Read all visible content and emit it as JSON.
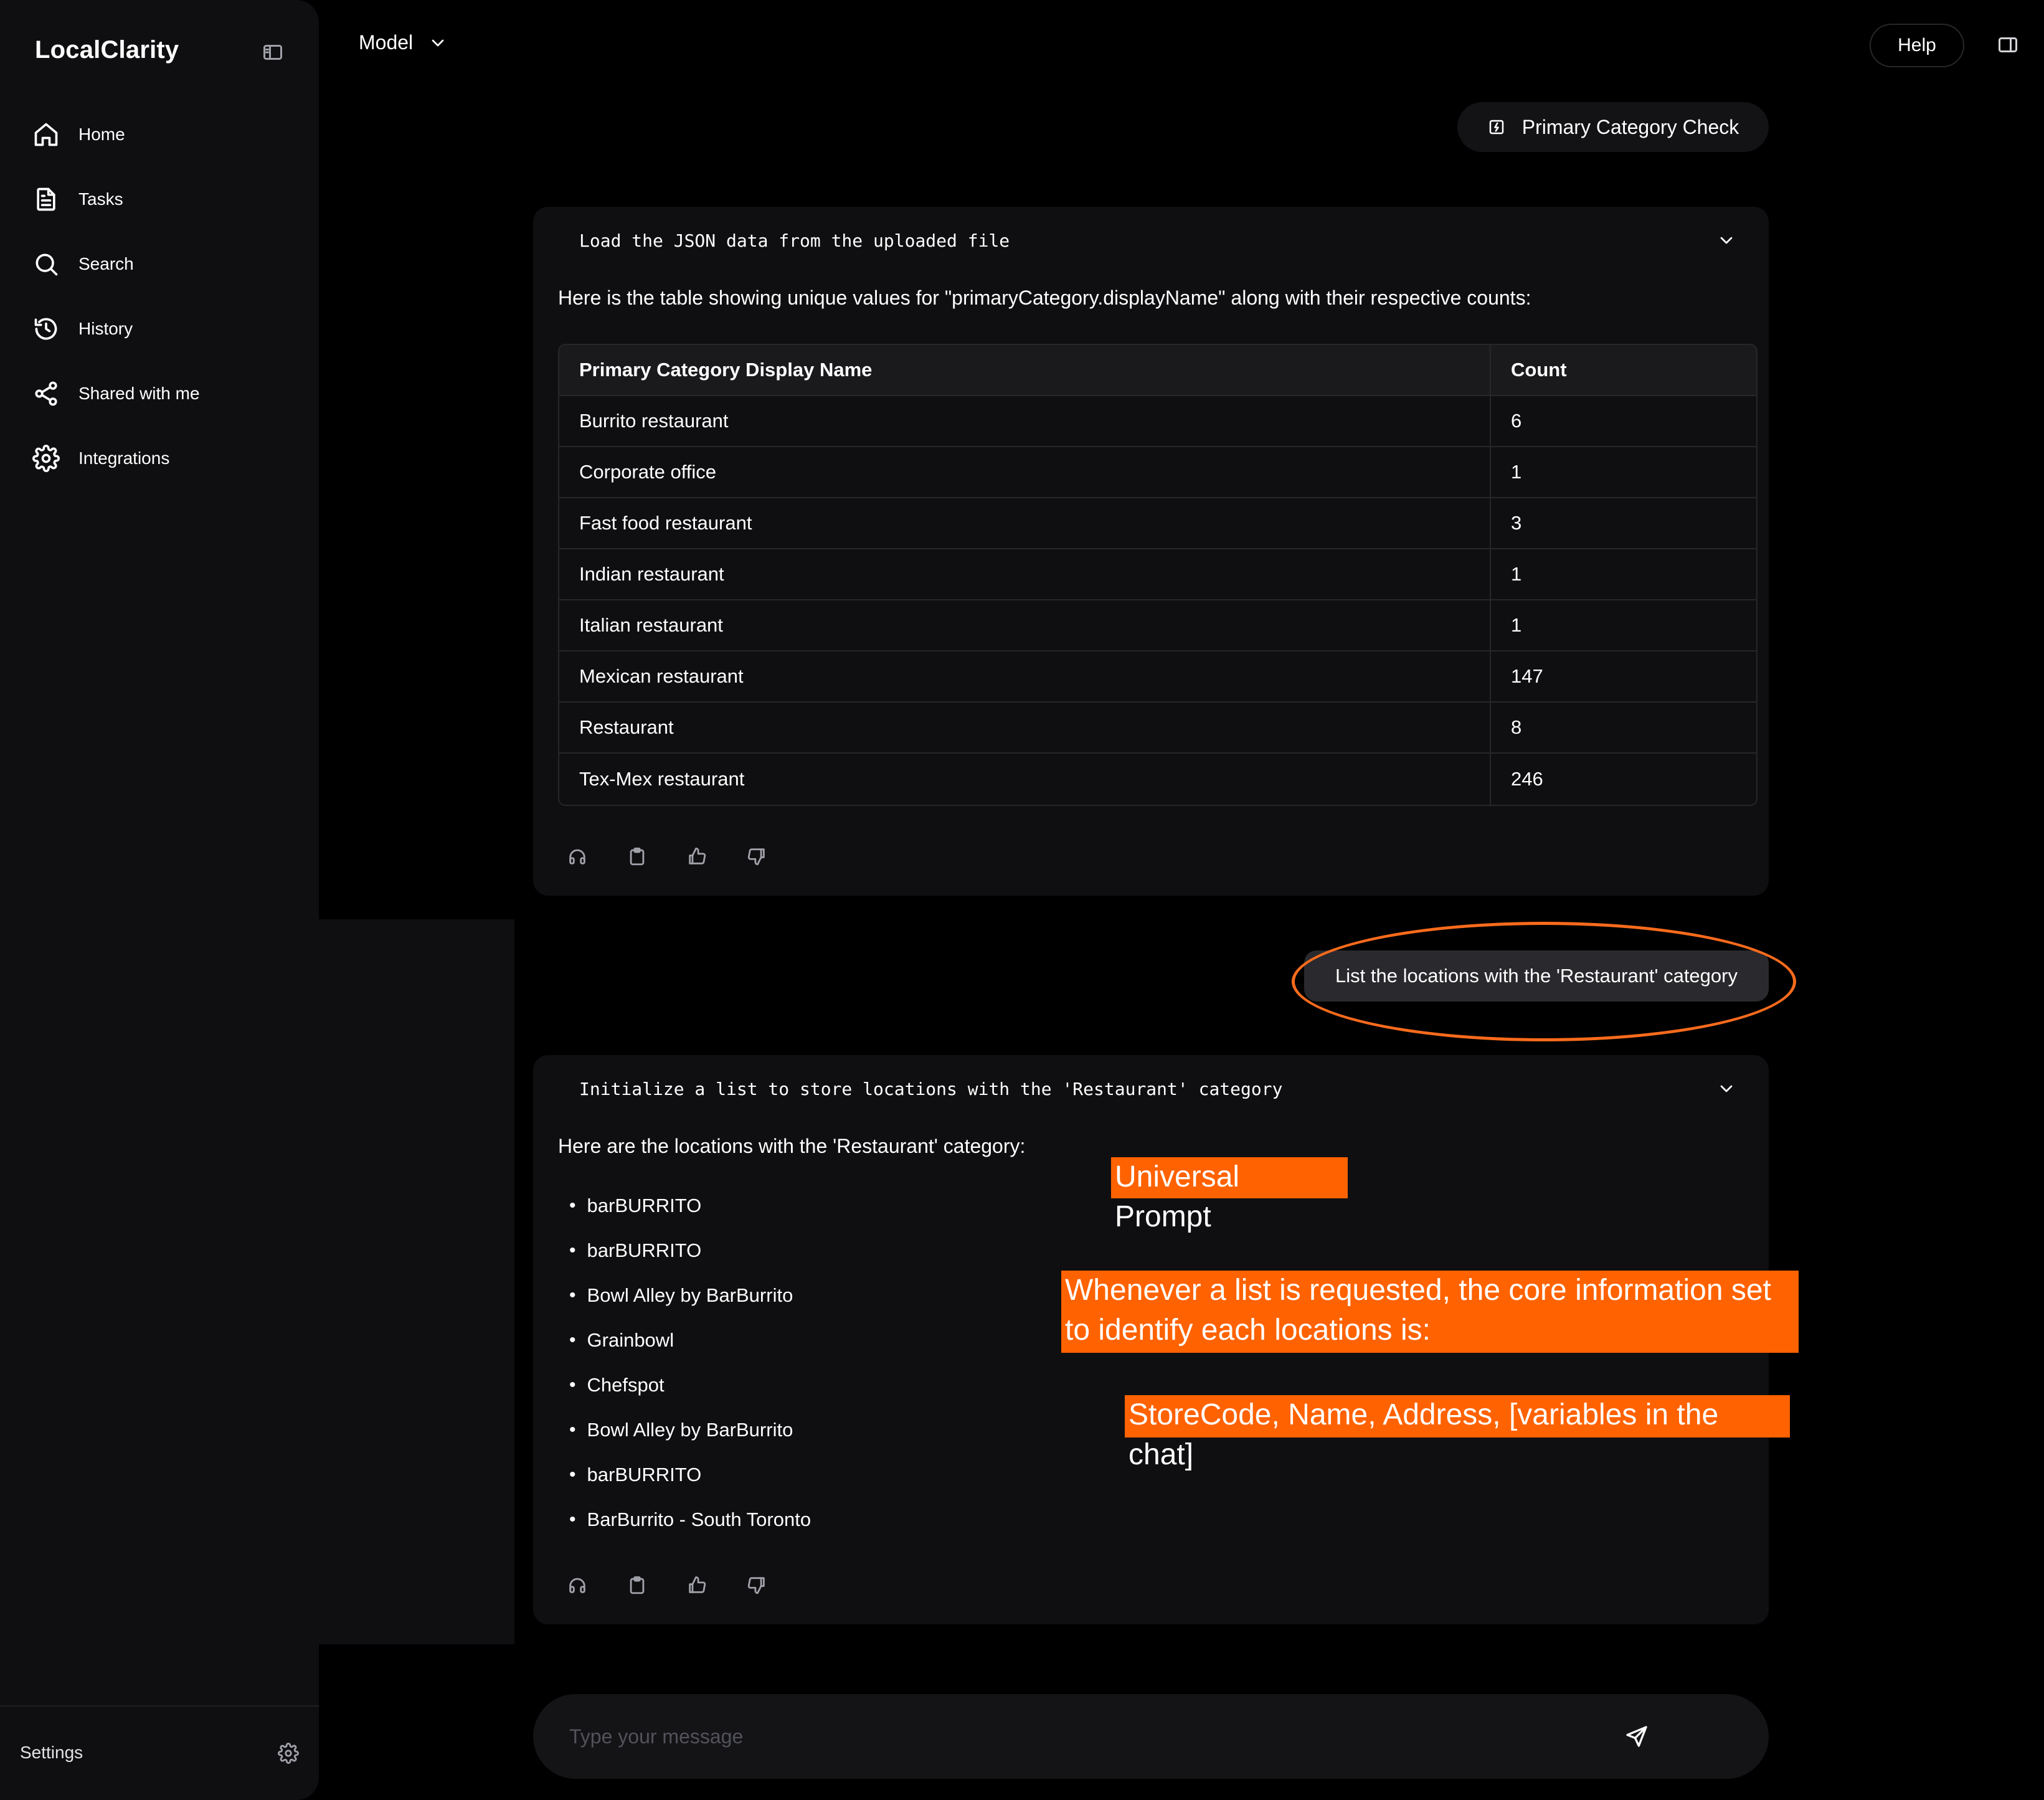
{
  "app": {
    "title": "LocalClarity"
  },
  "sidebar": {
    "items": [
      {
        "label": "Home",
        "icon": "home-icon"
      },
      {
        "label": "Tasks",
        "icon": "document-icon"
      },
      {
        "label": "Search",
        "icon": "search-icon"
      },
      {
        "label": "History",
        "icon": "history-icon"
      },
      {
        "label": "Shared with me",
        "icon": "share-icon"
      },
      {
        "label": "Integrations",
        "icon": "gear-icon"
      }
    ],
    "settings_label": "Settings"
  },
  "topbar": {
    "model_label": "Model",
    "help_label": "Help"
  },
  "chat": {
    "task_chip": "Primary Category Check",
    "card1": {
      "step": "Load the JSON data from the uploaded file",
      "intro": "Here is the table showing unique values for \"primaryCategory.displayName\" along with their respective counts:",
      "table": {
        "headers": [
          "Primary Category Display Name",
          "Count"
        ],
        "rows": [
          [
            "Burrito restaurant",
            "6"
          ],
          [
            "Corporate office",
            "1"
          ],
          [
            "Fast food restaurant",
            "3"
          ],
          [
            "Indian restaurant",
            "1"
          ],
          [
            "Italian restaurant",
            "1"
          ],
          [
            "Mexican restaurant",
            "147"
          ],
          [
            "Restaurant",
            "8"
          ],
          [
            "Tex-Mex restaurant",
            "246"
          ]
        ]
      }
    },
    "user_message": "List the locations with the 'Restaurant' category",
    "card2": {
      "step": "Initialize a list to store locations with the 'Restaurant' category",
      "intro": "Here are the locations with the 'Restaurant' category:",
      "items": [
        "barBURRITO",
        "barBURRITO",
        "Bowl Alley by BarBurrito",
        "Grainbowl",
        "Chefspot",
        "Bowl Alley by BarBurrito",
        "barBURRITO",
        "BarBurrito - South Toronto"
      ]
    },
    "composer": {
      "placeholder": "Type your message"
    }
  },
  "annotations": {
    "title": "Universal Prompt",
    "body": "Whenever a list is requested, the core information set to identify each locations is:",
    "fields": "StoreCode, Name, Address, [variables in the chat]",
    "color": "#ff6200",
    "ellipse_color": "#fa6b1c"
  }
}
